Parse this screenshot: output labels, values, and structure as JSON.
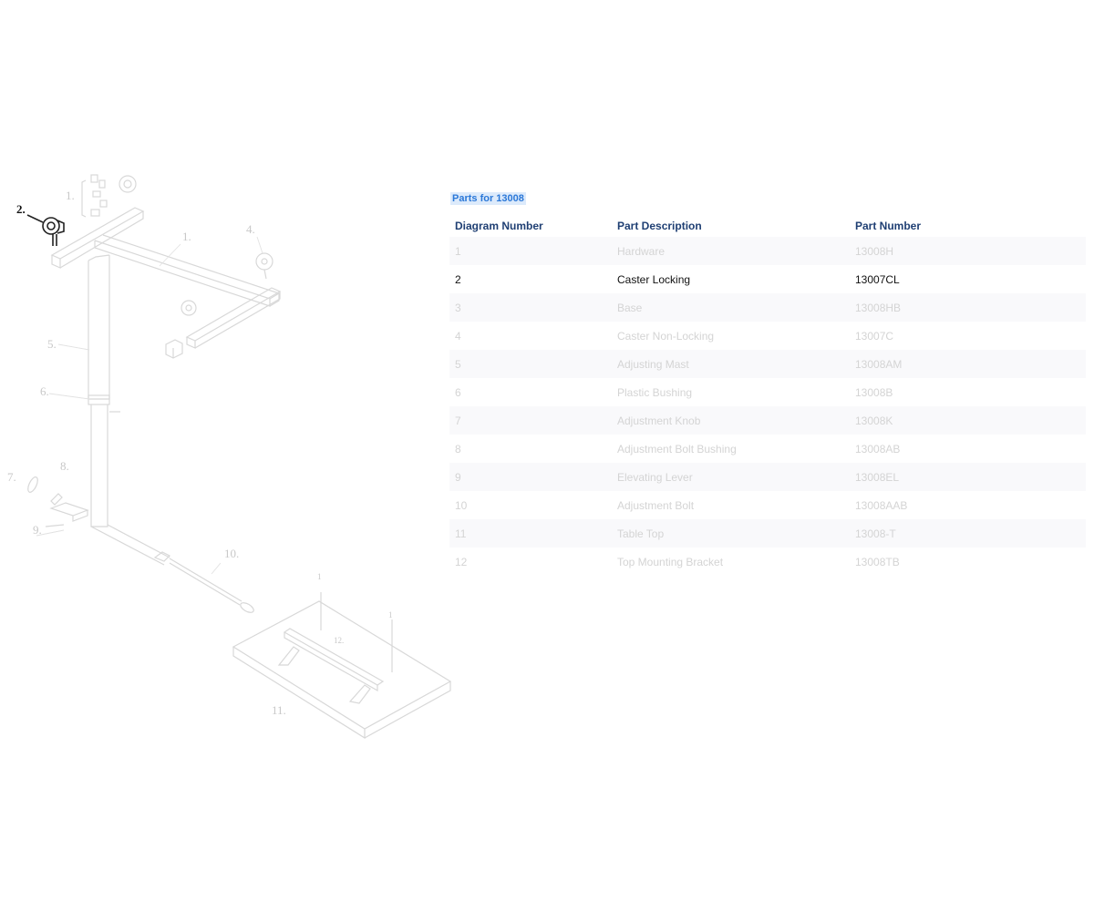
{
  "parts_title": "Parts for 13008",
  "columns": {
    "diagram_number": "Diagram Number",
    "part_description": "Part Description",
    "part_number": "Part Number"
  },
  "selected_diagram_number": "2",
  "rows": [
    {
      "num": "1",
      "desc": "Hardware",
      "part": "13008H"
    },
    {
      "num": "2",
      "desc": "Caster Locking",
      "part": "13007CL"
    },
    {
      "num": "3",
      "desc": "Base",
      "part": "13008HB"
    },
    {
      "num": "4",
      "desc": "Caster Non-Locking",
      "part": "13007C"
    },
    {
      "num": "5",
      "desc": "Adjusting Mast",
      "part": "13008AM"
    },
    {
      "num": "6",
      "desc": "Plastic Bushing",
      "part": "13008B"
    },
    {
      "num": "7",
      "desc": "Adjustment Knob",
      "part": "13008K"
    },
    {
      "num": "8",
      "desc": "Adjustment Bolt Bushing",
      "part": "13008AB"
    },
    {
      "num": "9",
      "desc": "Elevating Lever",
      "part": "13008EL"
    },
    {
      "num": "10",
      "desc": "Adjustment Bolt",
      "part": "13008AAB"
    },
    {
      "num": "11",
      "desc": "Table Top",
      "part": "13008-T"
    },
    {
      "num": "12",
      "desc": "Top Mounting Bracket",
      "part": "13008TB"
    }
  ],
  "diagram": {
    "callouts": {
      "c1a": "1.",
      "c1b": "1.",
      "c2": "2.",
      "c4": "4.",
      "c5": "5.",
      "c6": "6.",
      "c7": "7.",
      "c8": "8.",
      "c9": "9.",
      "c10": "10.",
      "c11": "11.",
      "c12": "12.",
      "c1c": "1",
      "c1d": "1"
    }
  }
}
